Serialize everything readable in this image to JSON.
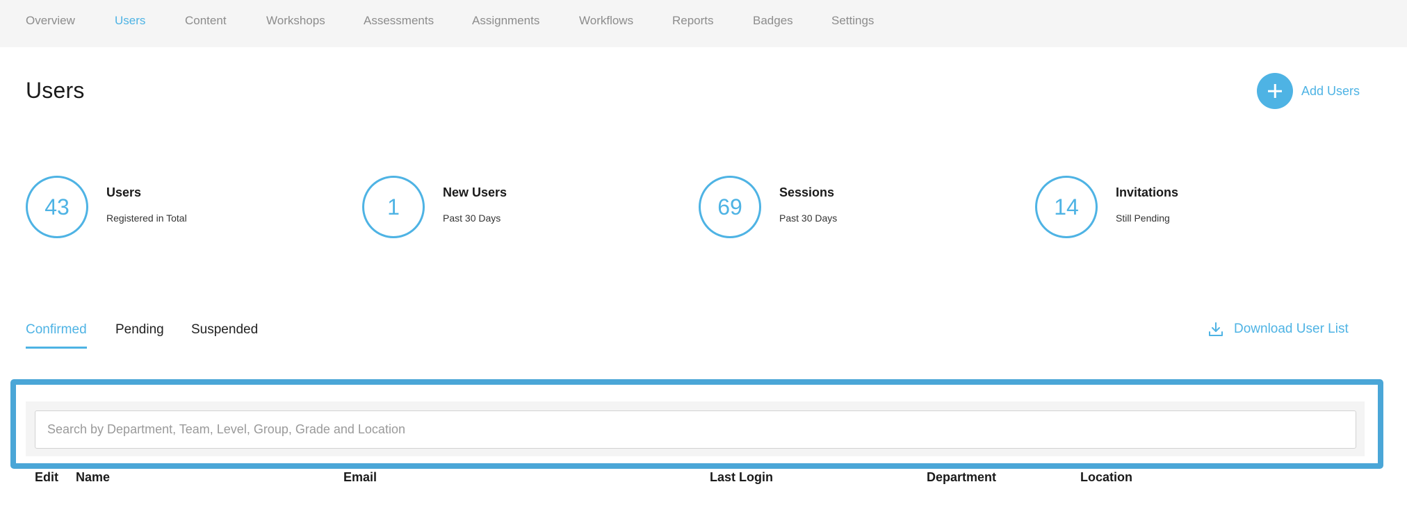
{
  "nav": {
    "items": [
      {
        "label": "Overview",
        "active": false
      },
      {
        "label": "Users",
        "active": true
      },
      {
        "label": "Content",
        "active": false
      },
      {
        "label": "Workshops",
        "active": false
      },
      {
        "label": "Assessments",
        "active": false
      },
      {
        "label": "Assignments",
        "active": false
      },
      {
        "label": "Workflows",
        "active": false
      },
      {
        "label": "Reports",
        "active": false
      },
      {
        "label": "Badges",
        "active": false
      },
      {
        "label": "Settings",
        "active": false
      }
    ]
  },
  "header": {
    "title": "Users",
    "add_button_label": "Add Users",
    "add_icon": "plus-icon"
  },
  "stats": [
    {
      "value": "43",
      "title": "Users",
      "subtitle": "Registered in Total"
    },
    {
      "value": "1",
      "title": "New Users",
      "subtitle": "Past 30 Days"
    },
    {
      "value": "69",
      "title": "Sessions",
      "subtitle": "Past 30 Days"
    },
    {
      "value": "14",
      "title": "Invitations",
      "subtitle": "Still Pending"
    }
  ],
  "tabs": [
    {
      "label": "Confirmed",
      "active": true
    },
    {
      "label": "Pending",
      "active": false
    },
    {
      "label": "Suspended",
      "active": false
    }
  ],
  "download": {
    "label": "Download User List",
    "icon": "download-icon"
  },
  "search": {
    "placeholder": "Search by Department, Team, Level, Group, Grade and Location",
    "value": ""
  },
  "table": {
    "columns": [
      "Edit",
      "Name",
      "Email",
      "Last Login",
      "Department",
      "Location"
    ]
  },
  "colors": {
    "accent": "#4eb3e4",
    "highlight_frame": "#4aa6d7",
    "nav_background": "#f5f5f5"
  }
}
